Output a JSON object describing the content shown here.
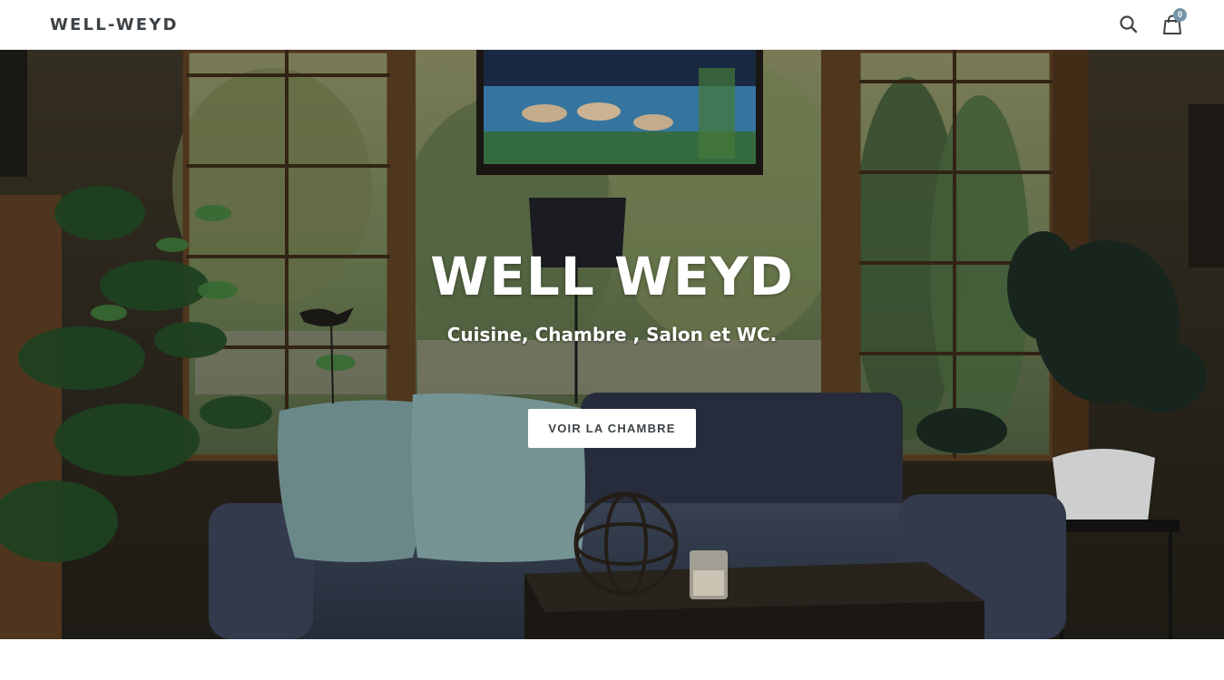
{
  "header": {
    "logo": "WELL-WEYD",
    "cart_count": "0"
  },
  "hero": {
    "title": "WELL WEYD",
    "subtitle": "Cuisine, Chambre , Salon et WC.",
    "button_label": "VOIR LA CHAMBRE"
  },
  "icons": {
    "search": "search-icon",
    "cart": "cart-icon"
  },
  "colors": {
    "text": "#3d4246",
    "cart_badge": "#7796a8",
    "button_bg": "#ffffff",
    "hero_text": "#ffffff"
  }
}
